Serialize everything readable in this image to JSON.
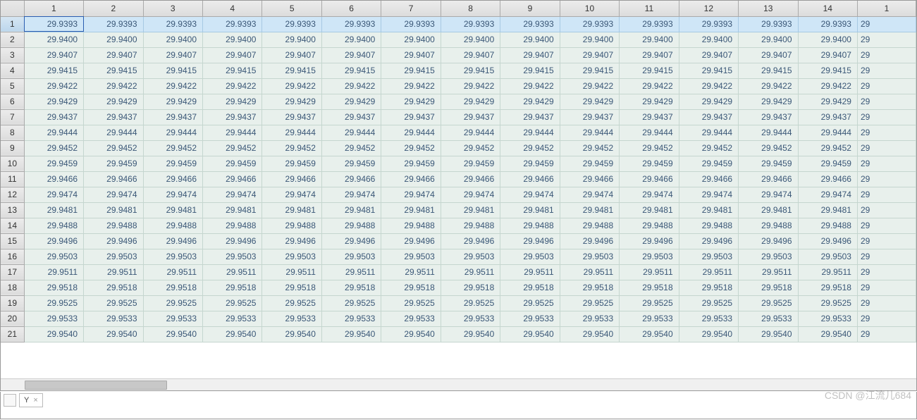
{
  "grid": {
    "col_headers": [
      "1",
      "2",
      "3",
      "4",
      "5",
      "6",
      "7",
      "8",
      "9",
      "10",
      "11",
      "12",
      "13",
      "14",
      "1"
    ],
    "row_headers": [
      "1",
      "2",
      "3",
      "4",
      "5",
      "6",
      "7",
      "8",
      "9",
      "10",
      "11",
      "12",
      "13",
      "14",
      "15",
      "16",
      "17",
      "18",
      "19",
      "20",
      "21"
    ],
    "selected_row_index": 0,
    "active_cell": {
      "row": 0,
      "col": 0
    },
    "row_values": [
      "29.9393",
      "29.9400",
      "29.9407",
      "29.9415",
      "29.9422",
      "29.9429",
      "29.9437",
      "29.9444",
      "29.9452",
      "29.9459",
      "29.9466",
      "29.9474",
      "29.9481",
      "29.9488",
      "29.9496",
      "29.9503",
      "29.9511",
      "29.9518",
      "29.9525",
      "29.9533",
      "29.9540"
    ],
    "partial_col_value_prefix": "29",
    "cols_visible": 15
  },
  "tabs": {
    "items": [
      {
        "label": "Y",
        "active": true
      }
    ],
    "add_label": ""
  },
  "watermark": "CSDN @江流儿684"
}
